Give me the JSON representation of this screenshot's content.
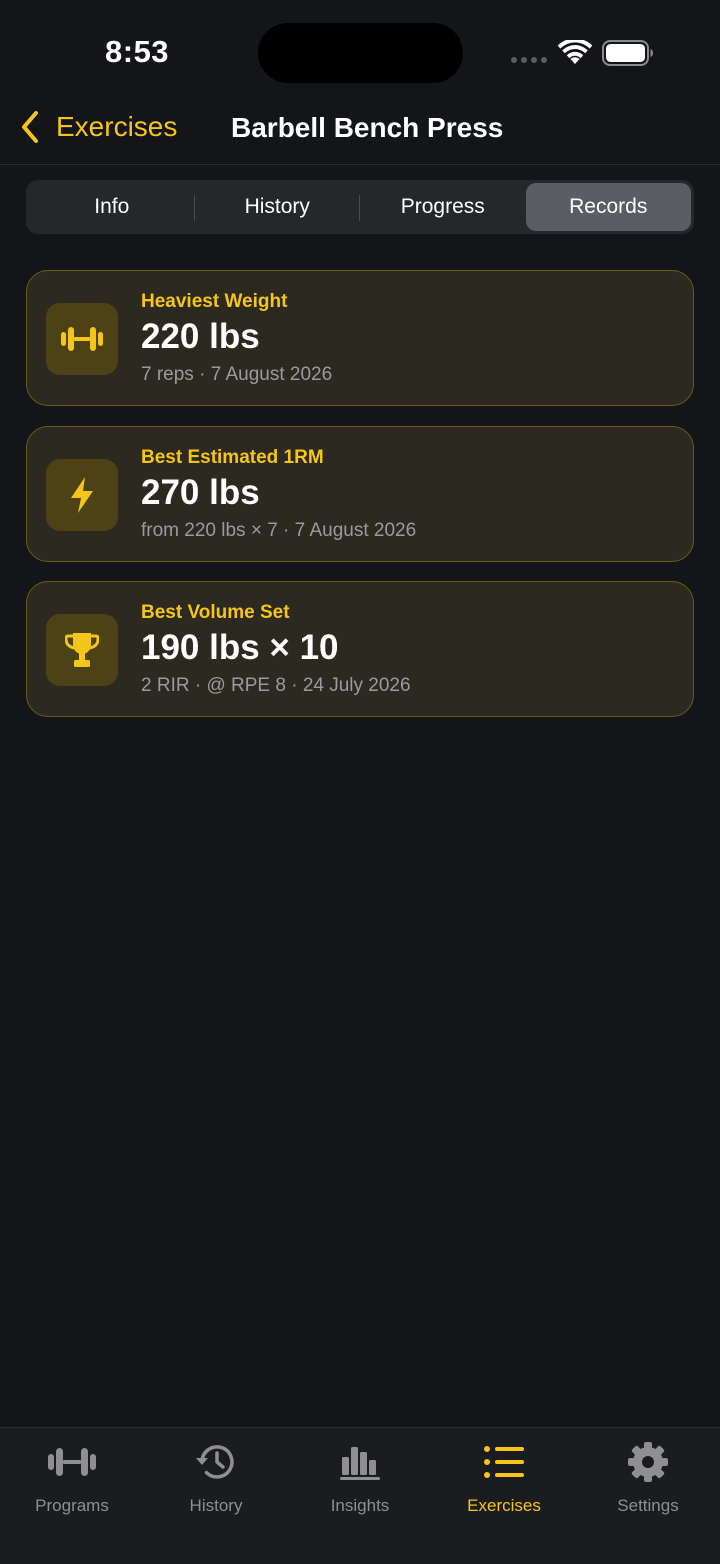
{
  "status_bar": {
    "time": "8:53"
  },
  "nav": {
    "back_label": "Exercises",
    "title": "Barbell Bench Press"
  },
  "segments": [
    {
      "label": "Info"
    },
    {
      "label": "History"
    },
    {
      "label": "Progress"
    },
    {
      "label": "Records",
      "selected": true
    }
  ],
  "records": [
    {
      "icon": "dumbbell-icon",
      "label": "Heaviest Weight",
      "value": "220 lbs",
      "detail": "7 reps · 7 August 2026"
    },
    {
      "icon": "bolt-icon",
      "label": "Best Estimated 1RM",
      "value": "270 lbs",
      "detail": "from 220 lbs × 7 · 7 August 2026"
    },
    {
      "icon": "trophy-icon",
      "label": "Best Volume Set",
      "value": "190 lbs × 10",
      "detail": "2 RIR · @ RPE 8 · 24 July 2026"
    }
  ],
  "tabs": [
    {
      "label": "Programs",
      "icon": "dumbbell-icon"
    },
    {
      "label": "History",
      "icon": "clock-history-icon"
    },
    {
      "label": "Insights",
      "icon": "bar-chart-icon"
    },
    {
      "label": "Exercises",
      "icon": "list-icon",
      "selected": true
    },
    {
      "label": "Settings",
      "icon": "gear-icon"
    }
  ],
  "colors": {
    "accent": "#f5c518",
    "background": "#141518",
    "card_background": "#2b2920",
    "card_border": "#6b5b18",
    "secondary_text": "#9a9aa0",
    "inactive_tab": "#8e8e93"
  }
}
